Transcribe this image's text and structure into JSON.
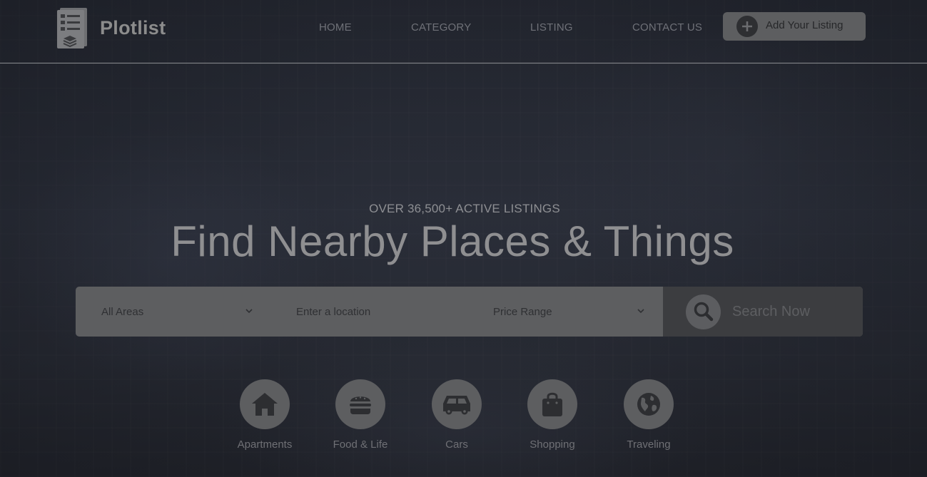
{
  "brand": {
    "name": "Plotlist",
    "logo_icon": "document-list-icon"
  },
  "nav": {
    "items": [
      {
        "label": "HOME"
      },
      {
        "label": "CATEGORY"
      },
      {
        "label": "LISTING"
      },
      {
        "label": "CONTACT US"
      }
    ],
    "add_listing": {
      "label": "Add Your Listing",
      "icon": "plus-circle-icon"
    }
  },
  "hero": {
    "subtitle": "OVER 36,500+ ACTIVE LISTINGS",
    "headline": "Find Nearby Places & Things"
  },
  "search": {
    "area_select": {
      "value": "All Areas"
    },
    "location_input": {
      "placeholder": "Enter a location",
      "value": ""
    },
    "price_select": {
      "value": "Price Range"
    },
    "submit": {
      "label": "Search Now",
      "icon": "search-icon"
    }
  },
  "categories": [
    {
      "label": "Apartments",
      "icon": "home-icon"
    },
    {
      "label": "Food & Life",
      "icon": "burger-icon"
    },
    {
      "label": "Cars",
      "icon": "car-icon"
    },
    {
      "label": "Shopping",
      "icon": "shopping-bag-icon"
    },
    {
      "label": "Traveling",
      "icon": "globe-icon"
    }
  ],
  "colors": {
    "overlay": "#1c1e24",
    "button_bg": "#5d5e60",
    "search_button_bg": "#3c3d40",
    "heading_text": "#8f8f91"
  }
}
